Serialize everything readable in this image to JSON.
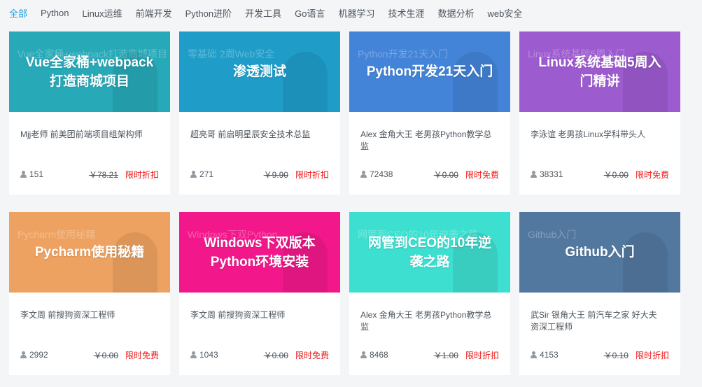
{
  "tabs": [
    "全部",
    "Python",
    "Linux运维",
    "前端开发",
    "Python进阶",
    "开发工具",
    "Go语言",
    "机器学习",
    "技术生涯",
    "数据分析",
    "web安全"
  ],
  "active_tab": "全部",
  "courses": [
    {
      "cover_title": "Vue全家桶+webpack打造商城项目",
      "cover_color": "#27a9b8",
      "cover_ghost": "Vue全家桶+webpack打造商城项目",
      "teacher": "Mjj老师 前美团前端项目组架构师",
      "students": "151",
      "old_price": "￥78.21",
      "promo": "限时折扣"
    },
    {
      "cover_title": "渗透测试",
      "cover_color": "#1f9dc8",
      "cover_ghost": "零基础 2周Web安全",
      "teacher": "超亮哥 前启明星辰安全技术总监",
      "students": "271",
      "old_price": "￥9.90",
      "promo": "限时折扣"
    },
    {
      "cover_title": "Python开发21天入门",
      "cover_color": "#4384d8",
      "cover_ghost": "Python开发21天入门",
      "teacher": "Alex 金角大王 老男孩Python教学总监",
      "students": "72438",
      "old_price": "￥0.00",
      "promo": "限时免费"
    },
    {
      "cover_title": "Linux系统基础5周入门精讲",
      "cover_color": "#9d5bd0",
      "cover_ghost": "Linux系统基础5周入门",
      "teacher": "李泳谊 老男孩Linux学科带头人",
      "students": "38331",
      "old_price": "￥0.00",
      "promo": "限时免费"
    },
    {
      "cover_title": "Pycharm使用秘籍",
      "cover_color": "#eea261",
      "cover_ghost": "Pycharm使用秘籍",
      "teacher": "李文周 前搜狗资深工程师",
      "students": "2992",
      "old_price": "￥0.00",
      "promo": "限时免费"
    },
    {
      "cover_title": "Windows下双版本Python环境安装",
      "cover_color": "#f2188b",
      "cover_ghost": "Windows下双Python",
      "teacher": "李文周 前搜狗资深工程师",
      "students": "1043",
      "old_price": "￥0.00",
      "promo": "限时免费"
    },
    {
      "cover_title": "网管到CEO的10年逆袭之路",
      "cover_color": "#3ddfd0",
      "cover_ghost": "网管到CEO的10年逆袭之路",
      "teacher": "Alex 金角大王 老男孩Python教学总监",
      "students": "8468",
      "old_price": "￥1.00",
      "promo": "限时折扣"
    },
    {
      "cover_title": "Github入门",
      "cover_color": "#53789f",
      "cover_ghost": "Github入门",
      "teacher": "武Sir 银角大王 前汽车之家 好大夫资深工程师",
      "students": "4153",
      "old_price": "￥0.10",
      "promo": "限时折扣"
    }
  ]
}
